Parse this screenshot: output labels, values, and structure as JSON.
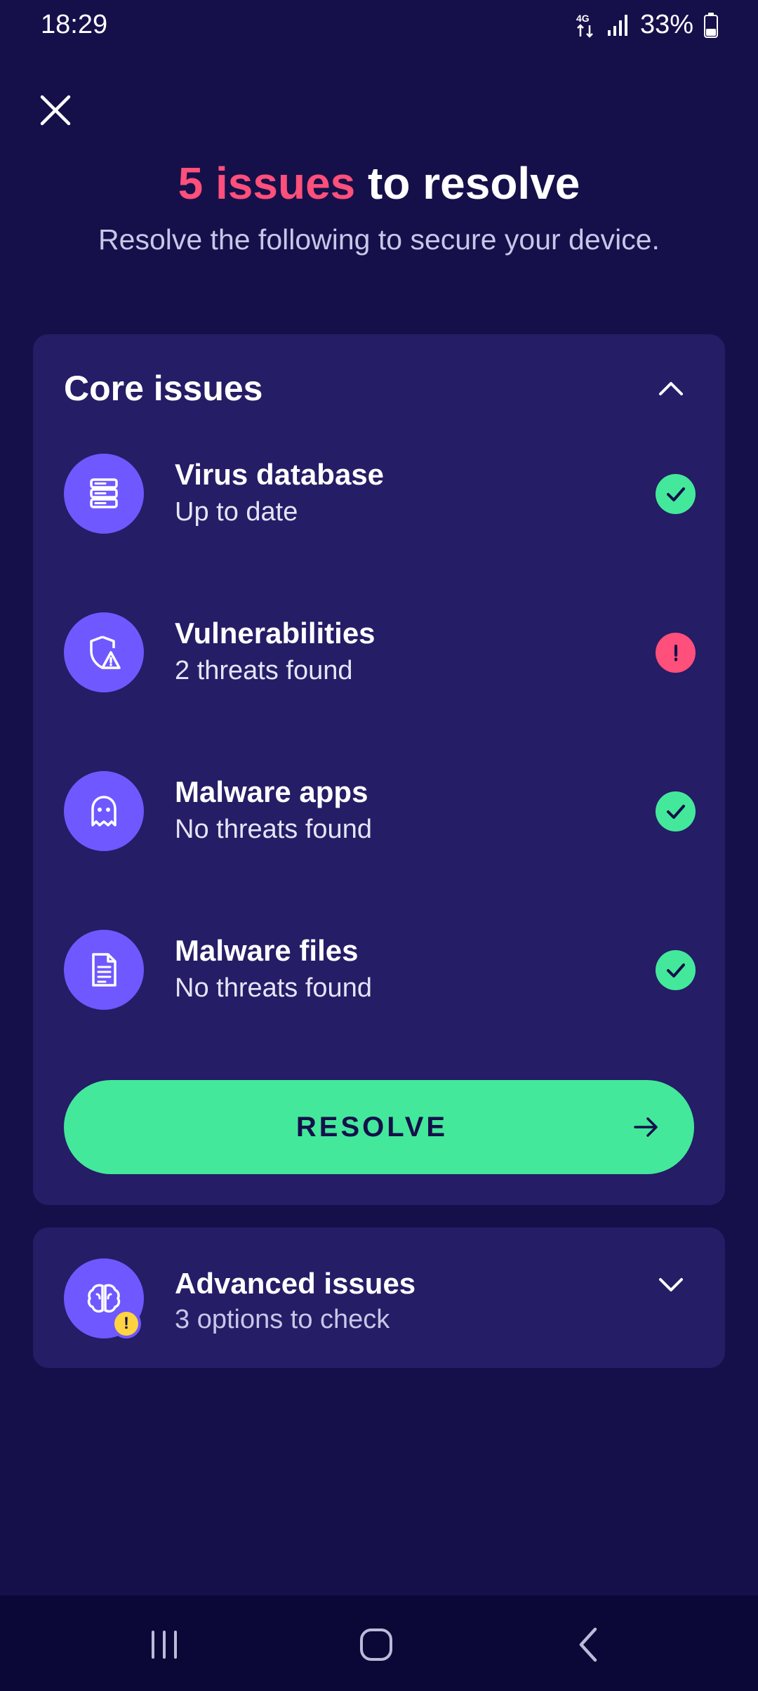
{
  "status_bar": {
    "time": "18:29",
    "network": "4G",
    "battery": "33%"
  },
  "header": {
    "title_count": "5 issues",
    "title_rest": " to resolve",
    "subtitle": "Resolve the following to secure your device."
  },
  "core": {
    "title": "Core issues",
    "items": [
      {
        "name": "Virus database",
        "status": "Up to date",
        "icon": "database-icon",
        "state": "ok"
      },
      {
        "name": "Vulnerabilities",
        "status": "2 threats found",
        "icon": "shield-warning-icon",
        "state": "warning"
      },
      {
        "name": "Malware apps",
        "status": "No threats found",
        "icon": "ghost-icon",
        "state": "ok"
      },
      {
        "name": "Malware files",
        "status": "No threats found",
        "icon": "file-icon",
        "state": "ok"
      }
    ],
    "resolve_label": "RESOLVE"
  },
  "advanced": {
    "title": "Advanced issues",
    "status": "3 options to check",
    "icon": "brain-icon",
    "badge": "!"
  },
  "colors": {
    "background": "#15104a",
    "card": "#251d66",
    "accent_red": "#ff4f7b",
    "accent_green": "#44e89b",
    "icon_bg": "#6f58ff",
    "badge_yellow": "#ffd440"
  }
}
